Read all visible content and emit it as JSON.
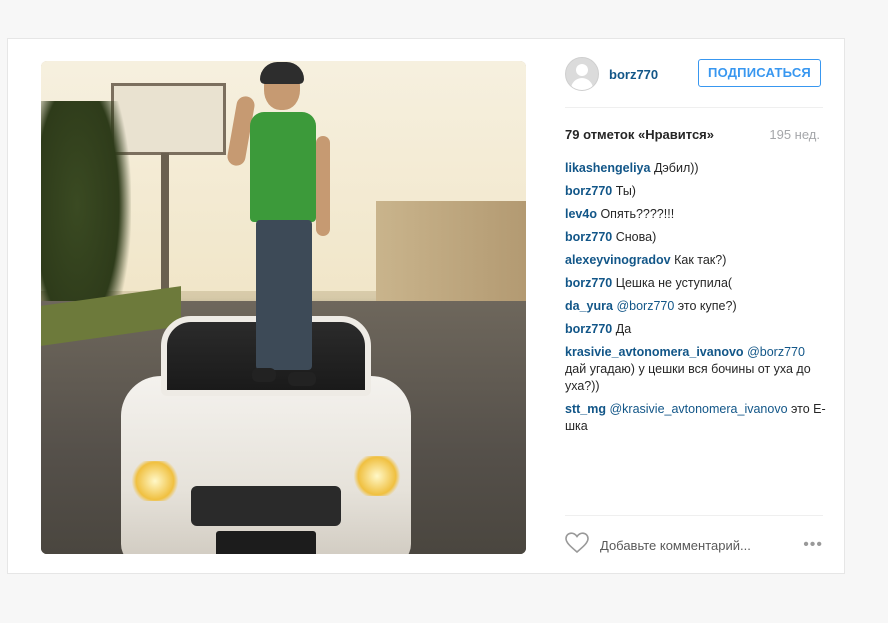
{
  "post": {
    "username": "borz770",
    "follow_label": "ПОДПИСАТЬСЯ",
    "likes": "79 отметок «Нравится»",
    "time": "195 нед.",
    "comments": [
      {
        "author": "likashengeliya",
        "text": "Дэбил))"
      },
      {
        "author": "borz770",
        "text": "Ты)"
      },
      {
        "author": "lev4o",
        "text": "Опять????!!!"
      },
      {
        "author": "borz770",
        "text": "Снова)"
      },
      {
        "author": "alexeyvinogradov",
        "text": "Как так?)"
      },
      {
        "author": "borz770",
        "text": "Цешка не уступила("
      },
      {
        "author": "da_yura",
        "mention": "@borz770",
        "text": "это купе?)"
      },
      {
        "author": "borz770",
        "text": "Да"
      },
      {
        "author": "krasivie_avtonomera_ivanovo",
        "mention": "@borz770",
        "text": "дай угадаю) у цешки вся бочины от уха до уха?))"
      },
      {
        "author": "stt_mg",
        "mention": "@krasivie_avtonomera_ivanovo",
        "text": "это Е-шка"
      }
    ],
    "add_comment_placeholder": "Добавьте комментарий...",
    "more_label": "•••"
  },
  "icons": {
    "avatar": "default-user-avatar",
    "heart": "heart-outline-icon",
    "more": "more-options-icon"
  },
  "colors": {
    "link": "#125688",
    "follow": "#3897f0",
    "muted": "#a5a7aa"
  }
}
